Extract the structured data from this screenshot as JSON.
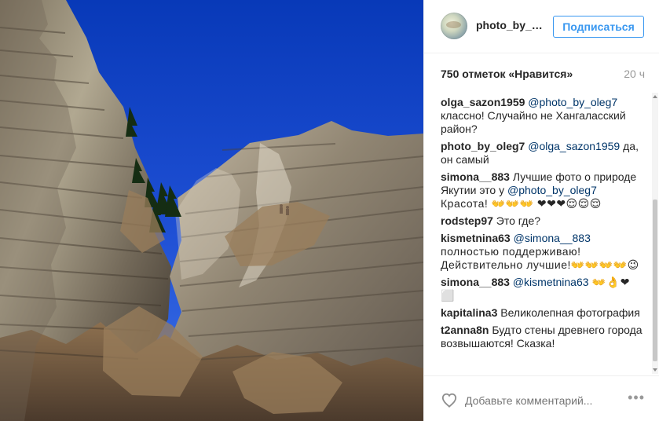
{
  "post": {
    "username": "photo_by_o...",
    "follow_label": "Подписаться",
    "likes": "750 отметок «Нравится»",
    "time": "20 ч"
  },
  "comments": [
    {
      "author": "olga_sazon1959",
      "mention": "@photo_by_oleg7",
      "text": " классно! Случайно не Хангаласский район?"
    },
    {
      "author": "photo_by_oleg7",
      "mention": "@olga_sazon1959",
      "text": " да, он самый"
    },
    {
      "author": "simona__883",
      "text": " Лучшие фото о природе Якутии это у ",
      "mention": "@photo_by_oleg7",
      "text_after": " Красота! 👐👐👐 ❤❤❤😌😌😌"
    },
    {
      "author": "rodstep97",
      "text": " Это где?"
    },
    {
      "author": "kismetnina63",
      "mention": "@simona__883",
      "text": " полностью поддерживаю! Действительно лучшие!👐👐👐👐😉"
    },
    {
      "author": "simona__883",
      "mention": "@kismetnina63",
      "text": " 👐👌❤⬜"
    },
    {
      "author": "kapitalina3",
      "text": " Великолепная фотография"
    },
    {
      "author": "t2anna8n",
      "text": " Будто стены древнего города возвышаются! Сказка!"
    }
  ],
  "footer": {
    "comment_placeholder": "Добавьте комментарий...",
    "more_label": "•••"
  },
  "colors": {
    "blue": "#3897f0",
    "mention": "#003569",
    "text": "#262626",
    "muted": "#999999"
  }
}
